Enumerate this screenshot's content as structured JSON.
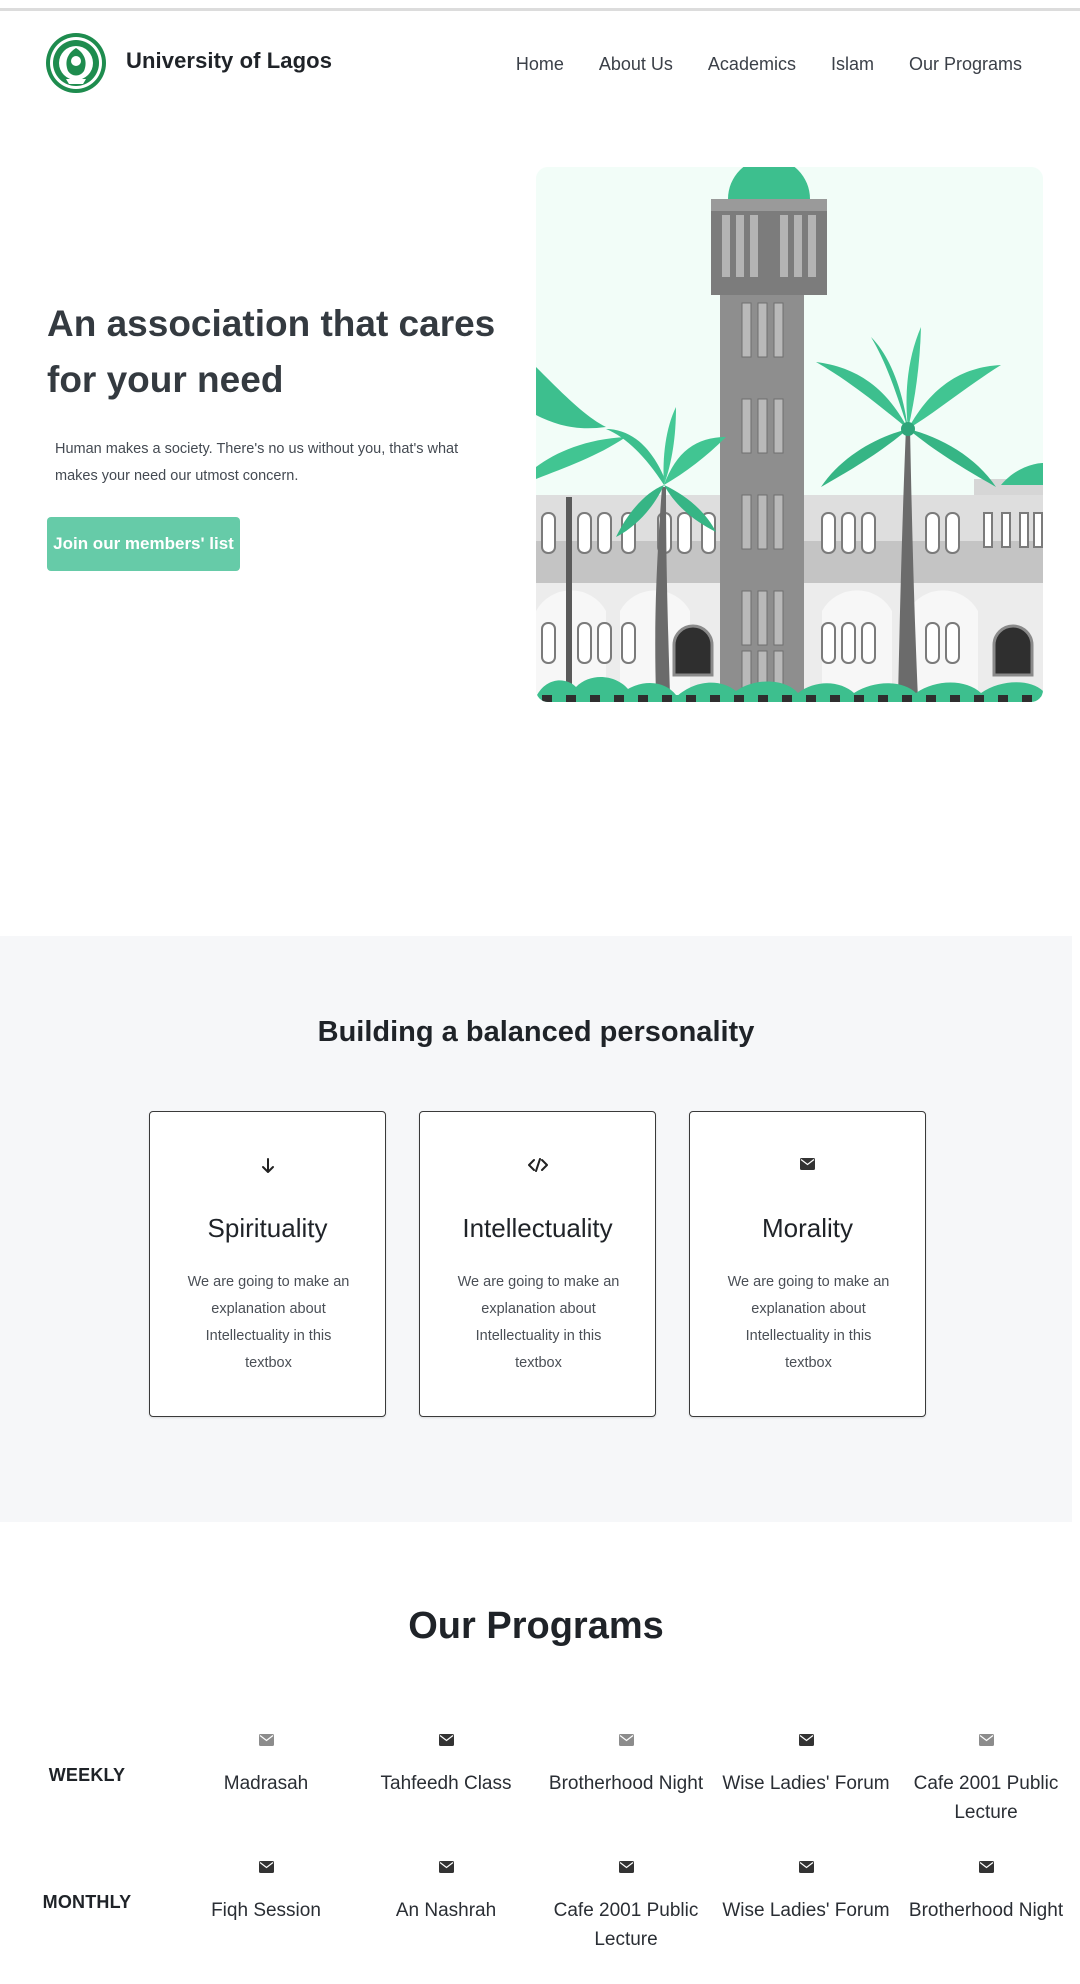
{
  "brand": {
    "name": "University of Lagos",
    "logo_icon": "university-crest-icon",
    "accent": "#1e8c4e"
  },
  "nav": {
    "items": [
      "Home",
      "About Us",
      "Academics",
      "Islam",
      "Our Programs"
    ]
  },
  "hero": {
    "title": "An association that cares for your need",
    "text": "Human makes a society. There's no us without you, that's what makes your need our utmost concern.",
    "button": "Join our members' list",
    "button_color": "#66cba8",
    "illustration": "university-tower-with-palm-trees"
  },
  "features": {
    "title": "Building a balanced personality",
    "cards": [
      {
        "icon": "arrow-down-icon",
        "title": "Spirituality",
        "text": "We are going to make an explanation about Intellectuality in this textbox"
      },
      {
        "icon": "code-icon",
        "title": "Intellectuality",
        "text": "We are going to make an explanation about Intellectuality in this textbox"
      },
      {
        "icon": "envelope-icon",
        "title": "Morality",
        "text": "We are going to make an explanation about Intellectuality in this textbox"
      }
    ]
  },
  "programs": {
    "title": "Our Programs",
    "rows": [
      {
        "label": "WEEKLY",
        "items": [
          {
            "icon": "envelope-icon",
            "name": "Madrasah"
          },
          {
            "icon": "envelope-icon",
            "name": "Tahfeedh Class"
          },
          {
            "icon": "envelope-icon",
            "name": "Brotherhood Night"
          },
          {
            "icon": "envelope-icon",
            "name": "Wise Ladies' Forum"
          },
          {
            "icon": "envelope-icon",
            "name": "Cafe 2001 Public Lecture"
          }
        ]
      },
      {
        "label": "MONTHLY",
        "items": [
          {
            "icon": "envelope-icon",
            "name": "Fiqh Session"
          },
          {
            "icon": "envelope-icon",
            "name": "An Nashrah"
          },
          {
            "icon": "envelope-icon",
            "name": "Cafe 2001 Public Lecture"
          },
          {
            "icon": "envelope-icon",
            "name": "Wise Ladies' Forum"
          },
          {
            "icon": "envelope-icon",
            "name": "Brotherhood Night"
          }
        ]
      }
    ]
  }
}
